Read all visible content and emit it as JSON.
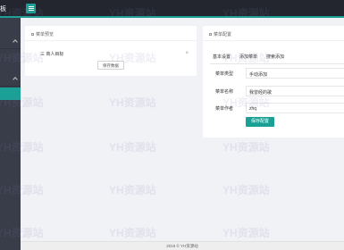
{
  "header": {
    "title": "板",
    "menu_icon": "hamburger-icon"
  },
  "left_panel": {
    "title": "菜单预览",
    "menu_item": "三 商人目标",
    "close_symbol": "×",
    "save_button": "保存数据"
  },
  "right_panel": {
    "title": "菜单配置",
    "tabs": [
      "基本设置",
      "添加菜单",
      "搜索添加"
    ],
    "fields": [
      {
        "label": "菜单类型",
        "value": "手动添加"
      },
      {
        "label": "菜单名称",
        "value": "我曾经的歌"
      },
      {
        "label": "菜单作者",
        "value": "zhq"
      }
    ],
    "save_button": "保存配置"
  },
  "footer": {
    "text": "2016 © YH资源站"
  },
  "watermark": {
    "text": "YH资源站"
  },
  "colors": {
    "accent": "#1aa094",
    "header_bg": "#23262e",
    "sidebar_bg": "#393d49"
  }
}
